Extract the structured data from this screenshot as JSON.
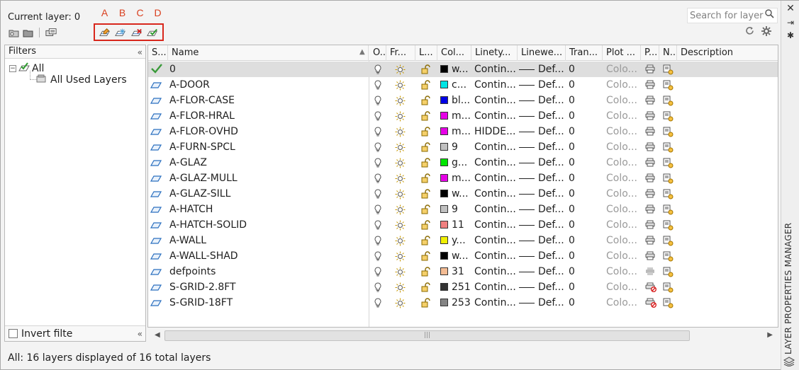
{
  "header": {
    "current_layer": "Current layer: 0",
    "search_placeholder": "Search for layer",
    "annotation_letters": [
      "A",
      "B",
      "C",
      "D"
    ]
  },
  "side_title": "LAYER PROPERTIES MANAGER",
  "filters": {
    "title": "Filters",
    "tree_root": "All",
    "tree_child": "All Used Layers",
    "invert_label": "Invert filte"
  },
  "columns": [
    "S...",
    "Name",
    "O...",
    "Fr...",
    "L...",
    "Col...",
    "Linety...",
    "Linewe...",
    "Tran...",
    "Plot ...",
    "P...",
    "N...",
    "Description"
  ],
  "layers": [
    {
      "name": "0",
      "current": true,
      "color": "w...",
      "swatch": "#000000",
      "linetype": "Contin...",
      "lineweight": "Def...",
      "trans": "0",
      "plot": "Colo...",
      "noplot": false
    },
    {
      "name": "A-DOOR",
      "current": false,
      "color": "c...",
      "swatch": "#00e5e5",
      "linetype": "Contin...",
      "lineweight": "Def...",
      "trans": "0",
      "plot": "Colo...",
      "noplot": false
    },
    {
      "name": "A-FLOR-CASE",
      "current": false,
      "color": "bl...",
      "swatch": "#0000e6",
      "linetype": "Contin...",
      "lineweight": "Def...",
      "trans": "0",
      "plot": "Colo...",
      "noplot": false
    },
    {
      "name": "A-FLOR-HRAL",
      "current": false,
      "color": "m...",
      "swatch": "#e600e6",
      "linetype": "Contin...",
      "lineweight": "Def...",
      "trans": "0",
      "plot": "Colo...",
      "noplot": false
    },
    {
      "name": "A-FLOR-OVHD",
      "current": false,
      "color": "m...",
      "swatch": "#e600e6",
      "linetype": "HIDDE...",
      "lineweight": "Def...",
      "trans": "0",
      "plot": "Colo...",
      "noplot": false
    },
    {
      "name": "A-FURN-SPCL",
      "current": false,
      "color": "9",
      "swatch": "#c0c0c0",
      "linetype": "Contin...",
      "lineweight": "Def...",
      "trans": "0",
      "plot": "Colo...",
      "noplot": false
    },
    {
      "name": "A-GLAZ",
      "current": false,
      "color": "g...",
      "swatch": "#00e600",
      "linetype": "Contin...",
      "lineweight": "Def...",
      "trans": "0",
      "plot": "Colo...",
      "noplot": false
    },
    {
      "name": "A-GLAZ-MULL",
      "current": false,
      "color": "m...",
      "swatch": "#e600e6",
      "linetype": "Contin...",
      "lineweight": "Def...",
      "trans": "0",
      "plot": "Colo...",
      "noplot": false
    },
    {
      "name": "A-GLAZ-SILL",
      "current": false,
      "color": "w...",
      "swatch": "#000000",
      "linetype": "Contin...",
      "lineweight": "Def...",
      "trans": "0",
      "plot": "Colo...",
      "noplot": false
    },
    {
      "name": "A-HATCH",
      "current": false,
      "color": "9",
      "swatch": "#c0c0c0",
      "linetype": "Contin...",
      "lineweight": "Def...",
      "trans": "0",
      "plot": "Colo...",
      "noplot": false
    },
    {
      "name": "A-HATCH-SOLID",
      "current": false,
      "color": "11",
      "swatch": "#f08080",
      "linetype": "Contin...",
      "lineweight": "Def...",
      "trans": "0",
      "plot": "Colo...",
      "noplot": false
    },
    {
      "name": "A-WALL",
      "current": false,
      "color": "y...",
      "swatch": "#f0f000",
      "linetype": "Contin...",
      "lineweight": "Def...",
      "trans": "0",
      "plot": "Colo...",
      "noplot": false
    },
    {
      "name": "A-WALL-SHAD",
      "current": false,
      "color": "w...",
      "swatch": "#000000",
      "linetype": "Contin...",
      "lineweight": "Def...",
      "trans": "0",
      "plot": "Colo...",
      "noplot": false
    },
    {
      "name": "defpoints",
      "current": false,
      "color": "31",
      "swatch": "#f4bc94",
      "linetype": "Contin...",
      "lineweight": "Def...",
      "trans": "0",
      "plot": "Colo...",
      "noplot": "disabled"
    },
    {
      "name": "S-GRID-2.8FT",
      "current": false,
      "color": "251",
      "swatch": "#333333",
      "linetype": "Contin...",
      "lineweight": "Def...",
      "trans": "0",
      "plot": "Colo...",
      "noplot": true
    },
    {
      "name": "S-GRID-18FT",
      "current": false,
      "color": "253",
      "swatch": "#848484",
      "linetype": "Contin...",
      "lineweight": "Def...",
      "trans": "0",
      "plot": "Colo...",
      "noplot": true
    }
  ],
  "status": "All: 16 layers displayed of 16 total layers",
  "colors": {
    "accent_red": "#d8271c",
    "selected_row": "#dedede",
    "layer_icon": "#2a6fbf",
    "check": "#3a9a3a"
  }
}
